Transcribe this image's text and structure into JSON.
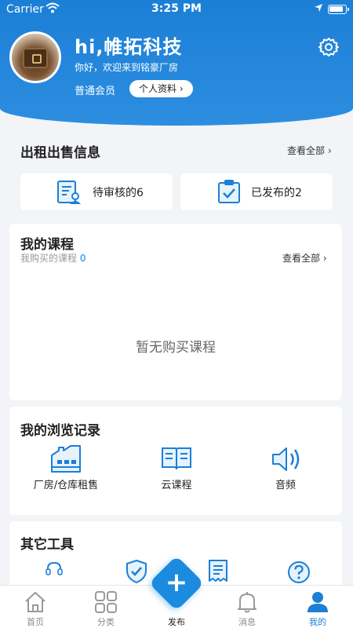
{
  "status_bar": {
    "carrier": "Carrier",
    "time": "3:25 PM"
  },
  "header": {
    "greeting": "hi,帷拓科技",
    "welcome": "你好，欢迎来到铭豪厂房",
    "member_level": "普通会员",
    "profile_button": "个人资料"
  },
  "rental_sale": {
    "title": "出租出售信息",
    "see_all": "查看全部",
    "stats": [
      {
        "label": "待审核的6",
        "icon": "review-document-icon"
      },
      {
        "label": "已发布的2",
        "icon": "clipboard-check-icon"
      }
    ]
  },
  "courses": {
    "title": "我的课程",
    "purchased_label": "我购买的课程",
    "purchased_count": "0",
    "see_all": "查看全部",
    "empty_text": "暂无购买课程"
  },
  "history": {
    "title": "我的浏览记录",
    "items": [
      {
        "label": "厂房/仓库租售",
        "icon": "factory-icon"
      },
      {
        "label": "云课程",
        "icon": "open-book-icon"
      },
      {
        "label": "音频",
        "icon": "speaker-icon"
      }
    ]
  },
  "tools": {
    "title": "其它工具",
    "items": [
      {
        "icon": "headset-icon"
      },
      {
        "icon": "shield-check-icon"
      },
      {
        "icon": "receipt-icon"
      },
      {
        "icon": "help-icon"
      }
    ]
  },
  "tabbar": {
    "items": [
      {
        "label": "首页",
        "icon": "home-icon"
      },
      {
        "label": "分类",
        "icon": "grid-icon"
      },
      {
        "label": "发布",
        "icon": "plus-icon"
      },
      {
        "label": "消息",
        "icon": "bell-icon"
      },
      {
        "label": "我的",
        "icon": "user-icon"
      }
    ],
    "active_index": 4
  },
  "colors": {
    "primary": "#1b7fd6",
    "background": "#f2f4f7",
    "inactive_tab": "#888888"
  }
}
